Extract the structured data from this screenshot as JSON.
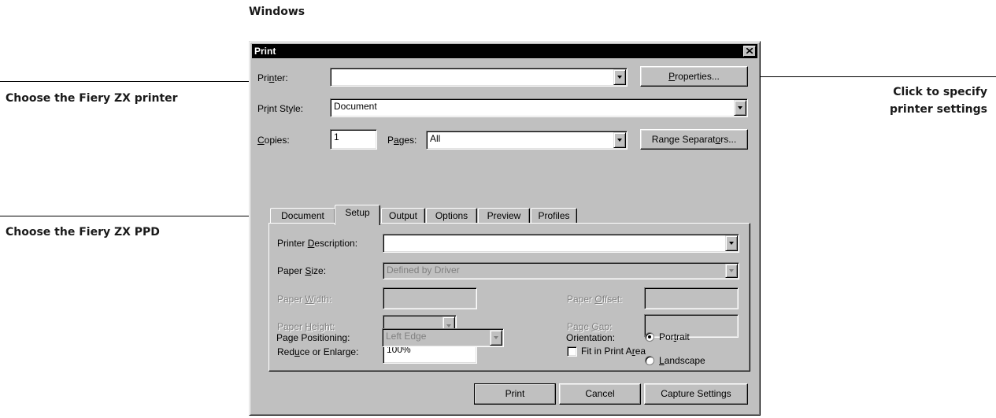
{
  "heading": "Windows",
  "callouts": {
    "printer": "Choose the Fiery ZX printer",
    "ppd": "Choose the Fiery ZX PPD",
    "properties_line1": "Click to specify",
    "properties_line2": "printer settings"
  },
  "dialog": {
    "title": "Print",
    "printer": {
      "label_pre": "Pri",
      "label_u": "n",
      "label_post": "ter:",
      "value": ""
    },
    "properties_button": {
      "u": "P",
      "rest": "roperties..."
    },
    "print_style": {
      "label_pre": "Pr",
      "label_u": "i",
      "label_post": "nt Style:",
      "value": "Document"
    },
    "copies": {
      "label_u": "C",
      "label_post": "opies:",
      "value": "1"
    },
    "pages": {
      "label_pre": "P",
      "label_u": "a",
      "label_post": "ges:",
      "value": "All"
    },
    "range_button": {
      "pre": "Range Separat",
      "u": "o",
      "post": "rs..."
    },
    "tabs": [
      "Document",
      "Setup",
      "Output",
      "Options",
      "Preview",
      "Profiles"
    ],
    "active_tab": "Setup",
    "setup": {
      "printer_description": {
        "label_pre": "Printer ",
        "label_u": "D",
        "label_post": "escription:",
        "value": ""
      },
      "paper_size": {
        "label_pre": "Paper ",
        "label_u": "S",
        "label_post": "ize:",
        "value": "Defined by Driver"
      },
      "paper_width": {
        "label_pre": "Paper ",
        "label_u": "W",
        "label_post": "idth:",
        "value": ""
      },
      "paper_height": {
        "label_pre": "Paper ",
        "label_u": "H",
        "label_post": "eight:",
        "value": ""
      },
      "paper_offset": {
        "label_pre": "Paper ",
        "label_u": "O",
        "label_post": "ffset:",
        "value": ""
      },
      "page_gap": {
        "label_pre": "Page ",
        "label_u": "G",
        "label_post": "ap:",
        "value": ""
      },
      "reduce_enlarge": {
        "label_pre": "Red",
        "label_u": "u",
        "label_post": "ce or Enlarge:",
        "value": "100%"
      },
      "fit_print_area": {
        "label_pre": "Fit in Print A",
        "label_u": "r",
        "label_post": "ea",
        "checked": false
      },
      "page_positioning": {
        "label_pre": "Pa",
        "label_u": "g",
        "label_post": "e Positioning:",
        "value": "Left Edge"
      },
      "orientation": {
        "label": "Orientation:",
        "portrait": {
          "pre": "Por",
          "u": "t",
          "post": "rait"
        },
        "landscape": {
          "u": "L",
          "post": "andscape"
        },
        "selected": "Portrait"
      }
    },
    "buttons": {
      "print": "Print",
      "cancel": "Cancel",
      "capture": "Capture Settings"
    }
  }
}
